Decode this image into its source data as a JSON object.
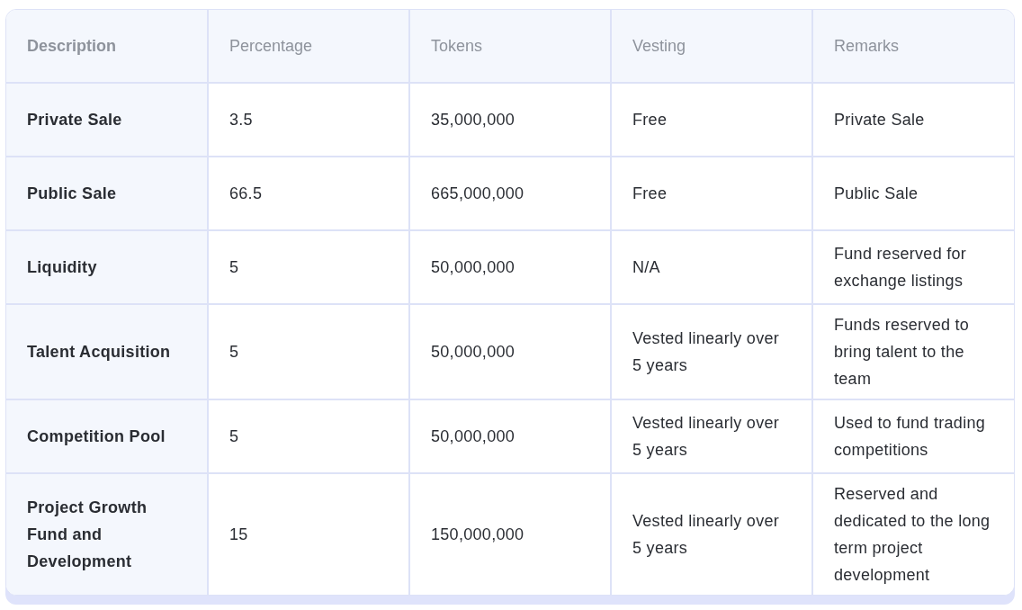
{
  "table": {
    "columns": [
      "Description",
      "Percentage",
      "Tokens",
      "Vesting",
      "Remarks"
    ],
    "rows": [
      {
        "cells": [
          "Private Sale",
          "3.5",
          "35,000,000",
          "Free",
          "Private Sale"
        ]
      },
      {
        "cells": [
          "Public Sale",
          "66.5",
          "665,000,000",
          "Free",
          "Public Sale"
        ]
      },
      {
        "cells": [
          "Liquidity",
          "5",
          "50,000,000",
          "N/A",
          "Fund reserved for exchange listings"
        ]
      },
      {
        "cells": [
          "Talent Acquisition",
          "5",
          "50,000,000",
          "Vested linearly over 5 years",
          "Funds reserved to bring talent to the team"
        ]
      },
      {
        "cells": [
          "Competition Pool",
          "5",
          "50,000,000",
          "Vested linearly over 5 years",
          "Used to fund trading competitions"
        ]
      },
      {
        "cells": [
          "Project Growth Fund and Development",
          "15",
          "150,000,000",
          "Vested linearly over 5 years",
          "Reserved and dedicated to the long term project development"
        ]
      }
    ]
  }
}
